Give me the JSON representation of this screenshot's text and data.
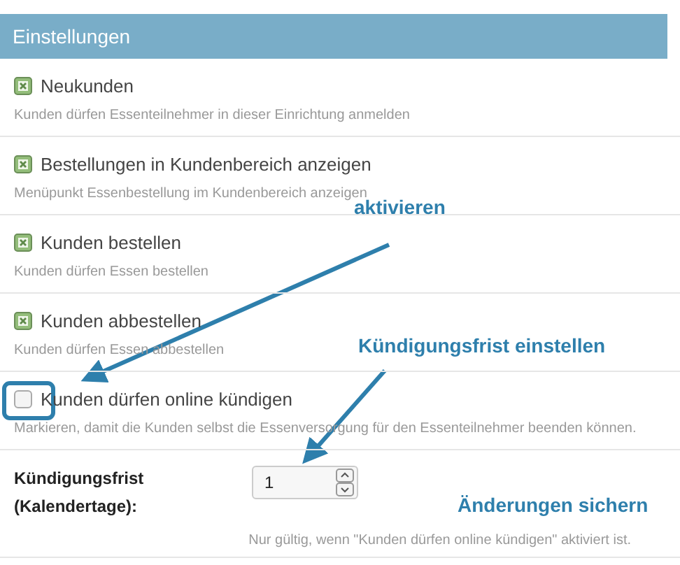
{
  "panel": {
    "title": "Einstellungen"
  },
  "settings": [
    {
      "kind": "checkbox",
      "label": "Neukunden",
      "description": "Kunden dürfen Essenteilnehmer in dieser Einrichtung anmelden",
      "checked": true
    },
    {
      "kind": "checkbox",
      "label": "Bestellungen in Kundenbereich anzeigen",
      "description": "Menüpunkt Essenbestellung im Kundenbereich anzeigen",
      "checked": true
    },
    {
      "kind": "checkbox",
      "label": "Kunden bestellen",
      "description": "Kunden dürfen Essen bestellen",
      "checked": true
    },
    {
      "kind": "checkbox",
      "label": "Kunden abbestellen",
      "description": "Kunden dürfen Essen abbestellen",
      "checked": true
    },
    {
      "kind": "checkbox",
      "label": "Kunden dürfen online kündigen",
      "description": "Markieren, damit die Kunden selbst die Essenversorgung für den Essenteilnehmer beenden können.",
      "checked": false
    },
    {
      "kind": "number",
      "label": "Kündigungsfrist\n(Kalendertage):",
      "value": "1",
      "description": "Nur gültig, wenn \"Kunden dürfen online kündigen\" aktiviert ist."
    }
  ],
  "annotations": [
    {
      "kind": "callout",
      "text": "aktivieren"
    },
    {
      "kind": "callout",
      "text": "Kündigungsfrist einstellen"
    },
    {
      "kind": "callout",
      "text": "Änderungen sichern"
    }
  ]
}
